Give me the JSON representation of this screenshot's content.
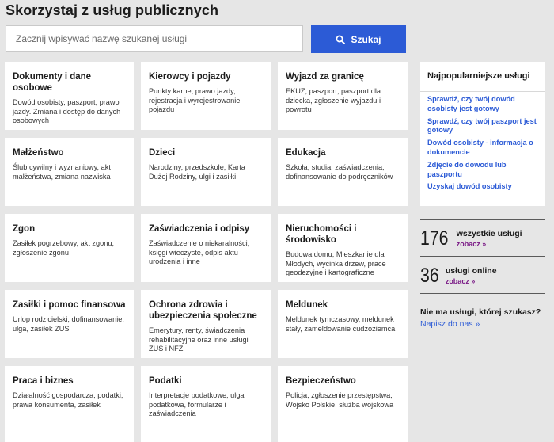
{
  "page": {
    "title": "Skorzystaj z usług publicznych"
  },
  "search": {
    "placeholder": "Zacznij wpisywać nazwę szukanej usługi",
    "button_label": "Szukaj"
  },
  "tiles": [
    {
      "title": "Dokumenty i dane osobowe",
      "desc": "Dowód osobisty, paszport, prawo jazdy. Zmiana i dostęp do danych osobowych"
    },
    {
      "title": "Kierowcy i pojazdy",
      "desc": "Punkty karne, prawo jazdy, rejestracja i wyrejestrowanie pojazdu"
    },
    {
      "title": "Wyjazd za granicę",
      "desc": "EKUZ, paszport, paszport dla dziecka, zgłoszenie wyjazdu i powrotu"
    },
    {
      "title": "Małżeństwo",
      "desc": "Ślub cywilny i wyznaniowy, akt małżeństwa, zmiana nazwiska"
    },
    {
      "title": "Dzieci",
      "desc": "Narodziny, przedszkole, Karta Dużej Rodziny, ulgi i zasiłki"
    },
    {
      "title": "Edukacja",
      "desc": "Szkoła, studia, zaświadczenia, dofinansowanie do podręczników"
    },
    {
      "title": "Zgon",
      "desc": "Zasiłek pogrzebowy, akt zgonu, zgłoszenie zgonu"
    },
    {
      "title": "Zaświadczenia i odpisy",
      "desc": "Zaświadczenie o niekaralności, księgi wieczyste, odpis aktu urodzenia i inne"
    },
    {
      "title": "Nieruchomości i środowisko",
      "desc": "Budowa domu, Mieszkanie dla Młodych, wycinka drzew, prace geodezyjne i kartograficzne"
    },
    {
      "title": "Zasiłki i pomoc finansowa",
      "desc": "Urlop rodzicielski, dofinansowanie, ulga, zasiłek ZUS"
    },
    {
      "title": "Ochrona zdrowia i ubezpieczenia społeczne",
      "desc": "Emerytury, renty, świadczenia rehabilitacyjne oraz inne usługi ZUS i NFZ"
    },
    {
      "title": "Meldunek",
      "desc": "Meldunek tymczasowy, meldunek stały, zameldowanie cudzoziemca"
    },
    {
      "title": "Praca i biznes",
      "desc": "Działalność gospodarcza, podatki, prawa konsumenta, zasiłek"
    },
    {
      "title": "Podatki",
      "desc": "Interpretacje podatkowe, ulga podatkowa, formularze i zaświadczenia"
    },
    {
      "title": "Bezpieczeństwo",
      "desc": "Policja, zgłoszenie przestępstwa, Wojsko Polskie, służba wojskowa"
    }
  ],
  "sidebar": {
    "title": "Najpopularniejsze usługi",
    "links": [
      "Sprawdź, czy twój dowód osobisty jest gotowy",
      "Sprawdź, czy twój paszport jest gotowy",
      "Dowód osobisty - informacja o dokumencie",
      "Zdjęcie do dowodu lub paszportu",
      "Uzyskaj dowód osobisty"
    ]
  },
  "stats": [
    {
      "number": "176",
      "label": "wszystkie usługi",
      "link": "zobacz »"
    },
    {
      "number": "36",
      "label": "usługi online",
      "link": "zobacz »"
    }
  ],
  "missing": {
    "title": "Nie ma usługi, której szukasz?",
    "link": "Napisz do nas »"
  },
  "colors": {
    "background": "#e6e6e6",
    "primary": "#2c5bd6",
    "visited_link": "#7a1a86"
  }
}
